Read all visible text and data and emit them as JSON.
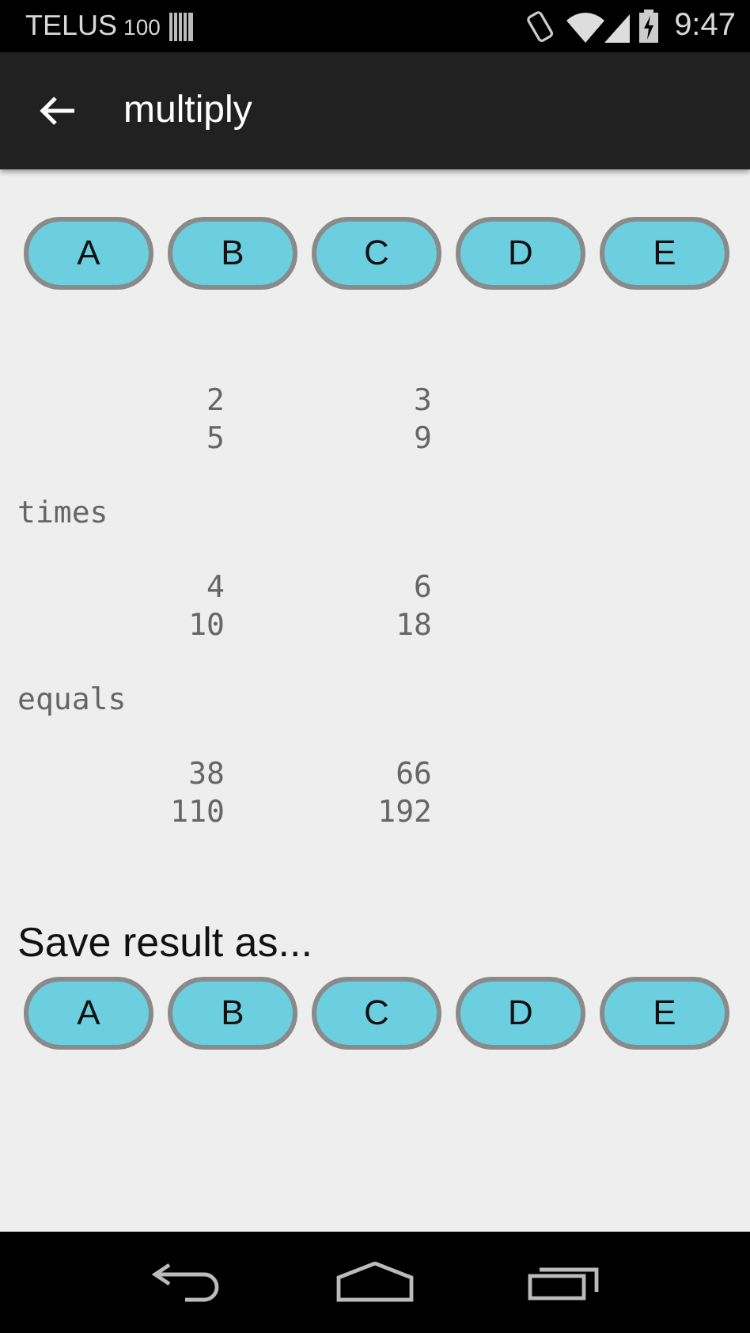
{
  "status_bar": {
    "carrier": "TELUS",
    "carrier_suffix": "100",
    "time": "9:47"
  },
  "app_bar": {
    "title": "multiply"
  },
  "source_buttons": [
    "A",
    "B",
    "C",
    "D",
    "E"
  ],
  "blocks": [
    {
      "kind": "matrix",
      "rows": [
        [
          "2",
          "3"
        ],
        [
          "5",
          "9"
        ]
      ]
    },
    {
      "kind": "label",
      "text": "times"
    },
    {
      "kind": "matrix",
      "rows": [
        [
          "4",
          "6"
        ],
        [
          "10",
          "18"
        ]
      ]
    },
    {
      "kind": "label",
      "text": "equals"
    },
    {
      "kind": "matrix",
      "rows": [
        [
          "38",
          "66"
        ],
        [
          "110",
          "192"
        ]
      ]
    }
  ],
  "save_label": "Save result as...",
  "target_buttons": [
    "A",
    "B",
    "C",
    "D",
    "E"
  ]
}
